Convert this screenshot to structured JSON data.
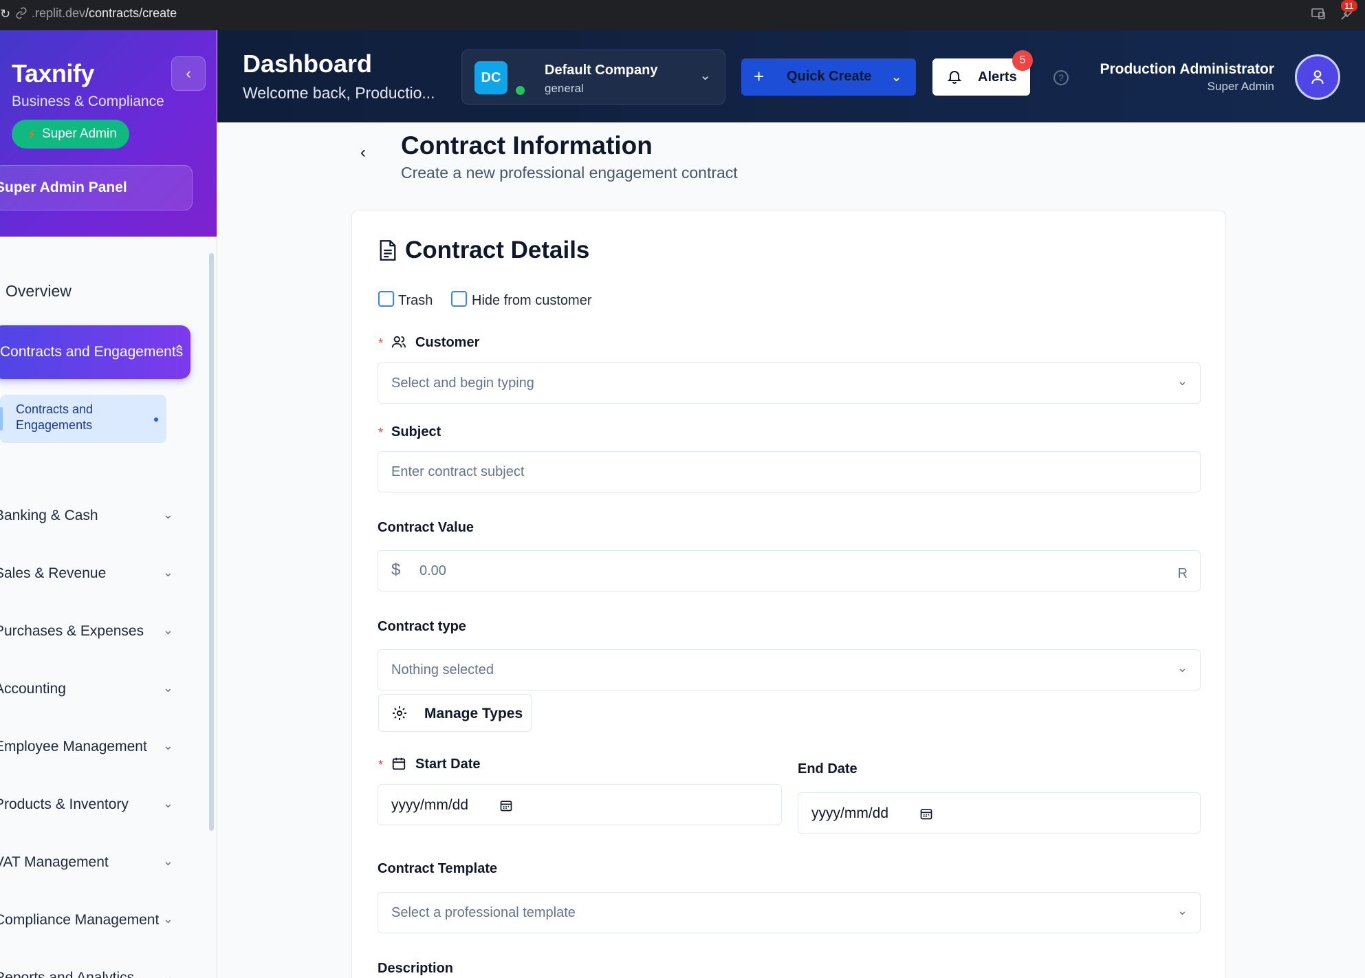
{
  "browser": {
    "url_host": ".replit.dev",
    "url_path": "/contracts/create",
    "extension_badge": "11"
  },
  "sidebar": {
    "brand": "Taxnify",
    "subtitle": "Business & Compliance",
    "role_badge": "Super Admin",
    "panel_button": "Super Admin Panel",
    "overview": "Overview",
    "active_group": "Contracts and Engagements",
    "active_sub_line1": "Contracts and",
    "active_sub_line2": "Engagements",
    "items": [
      {
        "label": "Banking & Cash"
      },
      {
        "label": "Sales & Revenue"
      },
      {
        "label": "Purchases & Expenses"
      },
      {
        "label": "Accounting"
      },
      {
        "label": "Employee Management"
      },
      {
        "label": "Products & Inventory"
      },
      {
        "label": "VAT Management"
      },
      {
        "label": "Compliance Management"
      },
      {
        "label": "Reports and Analytics"
      }
    ]
  },
  "header": {
    "title": "Dashboard",
    "welcome": "Welcome back, Productio...",
    "company_initials": "DC",
    "company_name": "Default Company",
    "company_type": "general",
    "quick_create": "Quick Create",
    "alerts": "Alerts",
    "alerts_count": "5",
    "help": "?",
    "user_name": "Production Administrator",
    "user_role": "Super Admin"
  },
  "page": {
    "title": "Contract Information",
    "subtitle": "Create a new professional engagement contract"
  },
  "form": {
    "card_title": "Contract Details",
    "trash_label": "Trash",
    "hide_label": "Hide from customer",
    "customer_label": "Customer",
    "customer_placeholder": "Select and begin typing",
    "subject_label": "Subject",
    "subject_placeholder": "Enter contract subject",
    "value_label": "Contract Value",
    "value_prefix": "$",
    "value_placeholder": "0.00",
    "value_suffix": "R",
    "type_label": "Contract type",
    "type_placeholder": "Nothing selected",
    "manage_types": "Manage Types",
    "start_label": "Start Date",
    "start_placeholder": "yyyy/mm/dd",
    "end_label": "End Date",
    "end_placeholder": "yyyy/mm/dd",
    "template_label": "Contract Template",
    "template_placeholder": "Select a professional template",
    "description_label": "Description",
    "required_mark": "*"
  },
  "colors": {
    "accent": "#1d4ed8",
    "sidebar_gradient_start": "#4338ca",
    "sidebar_gradient_end": "#7e22ce",
    "success": "#10b981",
    "danger": "#ef4444",
    "header_bg": "#0f1e3a"
  },
  "icons": {
    "card": "document-icon",
    "customer": "users-icon",
    "calendar": "calendar-icon",
    "gear": "gear-icon",
    "bell": "bell-icon",
    "user": "user-icon"
  }
}
